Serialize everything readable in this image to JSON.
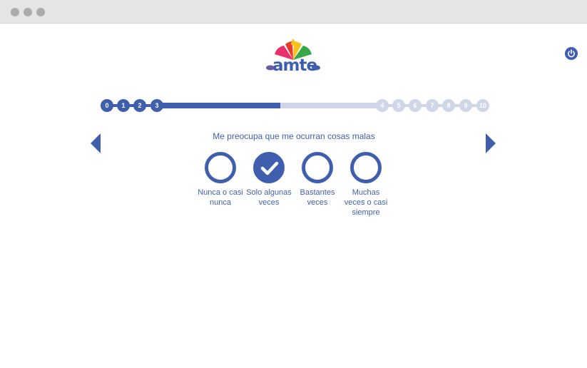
{
  "browser": {
    "controls": [
      "close",
      "minimize",
      "maximize"
    ]
  },
  "header": {
    "logo_text": "amte",
    "power_icon": "power-icon"
  },
  "progress": {
    "steps": [
      "0",
      "1",
      "2",
      "3",
      "4",
      "5",
      "6",
      "7",
      "8",
      "9",
      "10"
    ],
    "current_step": 3,
    "fill_fraction": 0.55,
    "done_color": "#3f5fae",
    "todo_color": "#cfd6e8"
  },
  "navigation": {
    "prev_icon": "arrow-left-icon",
    "next_icon": "arrow-right-icon"
  },
  "question": {
    "text": "Me preocupa que me ocurran cosas malas",
    "options": [
      {
        "label": "Nunca o casi nunca",
        "selected": false
      },
      {
        "label": "Solo algunas veces",
        "selected": true
      },
      {
        "label": "Bastantes veces",
        "selected": false
      },
      {
        "label": "Muchas veces o casi siempre",
        "selected": false
      }
    ]
  },
  "colors": {
    "accent": "#3f5fae",
    "light": "#cfd6e8",
    "chrome": "#e4e5e7"
  }
}
